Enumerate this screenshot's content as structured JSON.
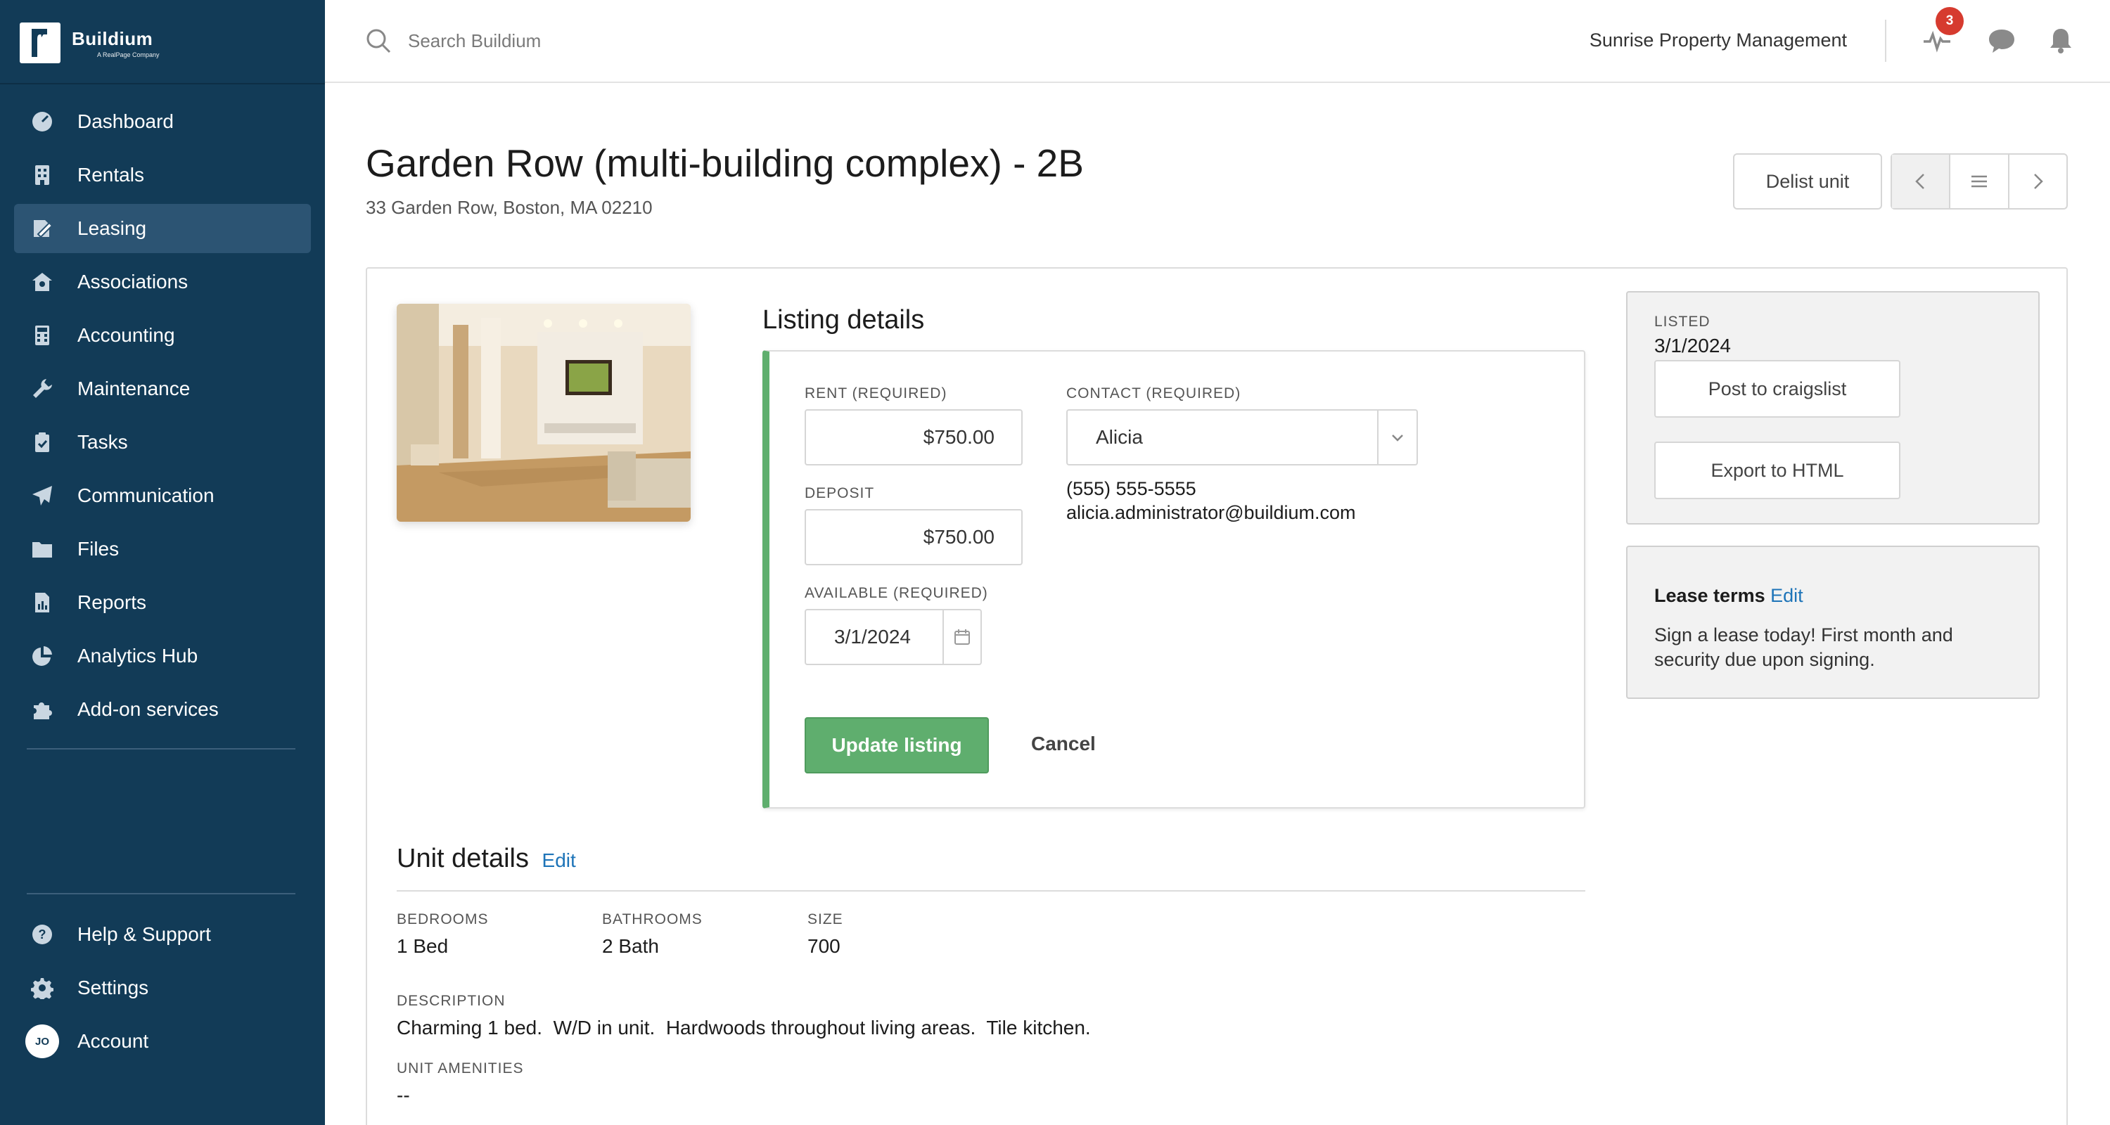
{
  "brand": {
    "name": "Buildium",
    "sub": "A RealPage Company"
  },
  "sidebar": {
    "items": [
      {
        "label": "Dashboard",
        "icon": "dashboard-icon"
      },
      {
        "label": "Rentals",
        "icon": "building-icon"
      },
      {
        "label": "Leasing",
        "icon": "leasing-icon",
        "active": true
      },
      {
        "label": "Associations",
        "icon": "association-icon"
      },
      {
        "label": "Accounting",
        "icon": "calculator-icon"
      },
      {
        "label": "Maintenance",
        "icon": "wrench-icon"
      },
      {
        "label": "Tasks",
        "icon": "clipboard-icon"
      },
      {
        "label": "Communication",
        "icon": "paper-plane-icon"
      },
      {
        "label": "Files",
        "icon": "folder-icon"
      },
      {
        "label": "Reports",
        "icon": "report-icon"
      },
      {
        "label": "Analytics Hub",
        "icon": "pie-chart-icon"
      },
      {
        "label": "Add-on services",
        "icon": "puzzle-icon"
      }
    ],
    "bottom": [
      {
        "label": "Help & Support",
        "icon": "help-icon"
      },
      {
        "label": "Settings",
        "icon": "gear-icon"
      },
      {
        "label": "Account",
        "avatar": "JO"
      }
    ]
  },
  "header": {
    "search_placeholder": "Search Buildium",
    "company": "Sunrise Property Management",
    "activity_badge": "3"
  },
  "page": {
    "title": "Garden Row (multi-building complex) - 2B",
    "address": "33 Garden Row, Boston, MA 02210",
    "delist_label": "Delist unit"
  },
  "listing": {
    "title": "Listing details",
    "rent_label": "RENT (REQUIRED)",
    "rent_value": "$750.00",
    "deposit_label": "DEPOSIT",
    "deposit_value": "$750.00",
    "available_label": "AVAILABLE (REQUIRED)",
    "available_value": "3/1/2024",
    "contact_label": "CONTACT (REQUIRED)",
    "contact_value": "Alicia",
    "contact_phone": "(555) 555-5555",
    "contact_email": "alicia.administrator@buildium.com",
    "update_label": "Update listing",
    "cancel_label": "Cancel"
  },
  "status_panel": {
    "listed_label": "LISTED",
    "listed_value": "3/1/2024",
    "craigslist_label": "Post to craigslist",
    "export_label": "Export to HTML"
  },
  "lease_terms": {
    "title": "Lease terms",
    "edit_label": "Edit",
    "text": "Sign a lease today! First month and security due upon signing."
  },
  "unit_details": {
    "title": "Unit details",
    "edit_label": "Edit",
    "bedrooms_label": "BEDROOMS",
    "bedrooms_value": "1 Bed",
    "bathrooms_label": "BATHROOMS",
    "bathrooms_value": "2 Bath",
    "size_label": "SIZE",
    "size_value": "700",
    "description_label": "DESCRIPTION",
    "description_value": "Charming 1 bed.  W/D in unit.  Hardwoods throughout living areas.  Tile kitchen.",
    "amenities_label": "UNIT AMENITIES",
    "amenities_value": "--"
  },
  "colors": {
    "sidebar_bg": "#123b57",
    "active_item": "#2c5473",
    "accent_green": "#5fae6e",
    "link_blue": "#1e74b8",
    "badge_red": "#d63b2f"
  }
}
